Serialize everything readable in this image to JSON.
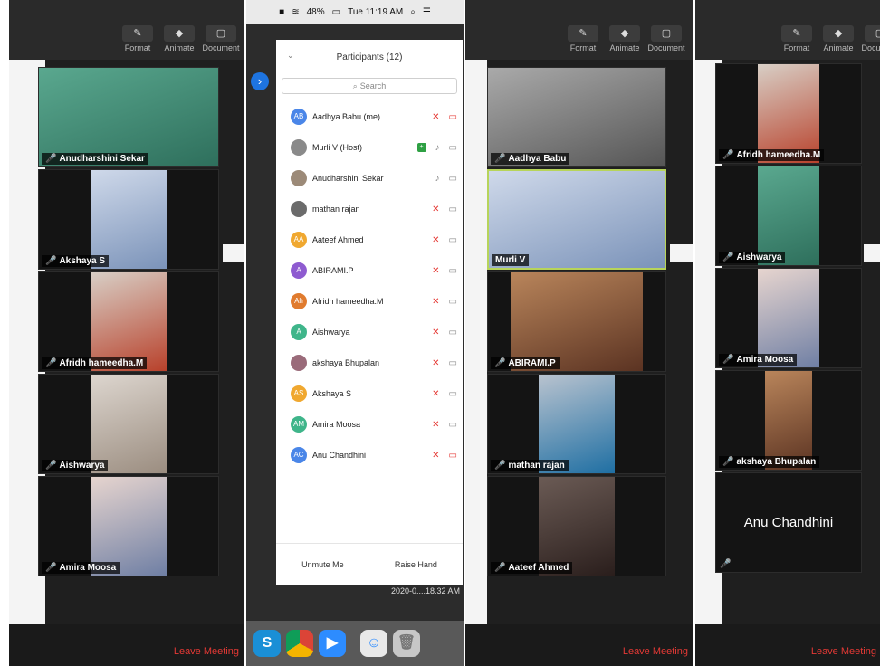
{
  "toolbar": {
    "format": "Format",
    "animate": "Animate",
    "document": "Document"
  },
  "leave_meeting": "Leave Meeting",
  "panel1": {
    "tiles": [
      {
        "name": "Anudharshini Sekar"
      },
      {
        "name": "Akshaya S"
      },
      {
        "name": "Afridh hameedha.M"
      },
      {
        "name": "Aishwarya"
      },
      {
        "name": "Amira Moosa"
      }
    ]
  },
  "mobile": {
    "status": {
      "battery": "48%",
      "time": "Tue 11:19 AM"
    },
    "participants_title": "Participants (12)",
    "search_placeholder": "Search",
    "participants": [
      {
        "initials": "AB",
        "name": "Aadhya Babu (me)",
        "color": "#4a86e8"
      },
      {
        "initials": "",
        "name": "Murli V (Host)",
        "color": "#8a8a8a"
      },
      {
        "initials": "",
        "name": "Anudharshini Sekar",
        "color": "#9c8a78"
      },
      {
        "initials": "",
        "name": "mathan rajan",
        "color": "#6b6b6b"
      },
      {
        "initials": "AA",
        "name": "Aateef Ahmed",
        "color": "#f0a830"
      },
      {
        "initials": "A",
        "name": "ABIRAMI.P",
        "color": "#8e5bd0"
      },
      {
        "initials": "Ah",
        "name": "Afridh hameedha.M",
        "color": "#e07b2e"
      },
      {
        "initials": "A",
        "name": "Aishwarya",
        "color": "#3fb58a"
      },
      {
        "initials": "",
        "name": "akshaya Bhupalan",
        "color": "#9a6b7a"
      },
      {
        "initials": "AS",
        "name": "Akshaya S",
        "color": "#f0a830"
      },
      {
        "initials": "AM",
        "name": "Amira Moosa",
        "color": "#3fb58a"
      },
      {
        "initials": "AC",
        "name": "Anu Chandhini",
        "color": "#4a86e8"
      }
    ],
    "unmute_label": "Unmute Me",
    "raise_hand_label": "Raise Hand",
    "timestamp": "2020-0....18.32 AM"
  },
  "panel3": {
    "tiles": [
      {
        "name": "Aadhya Babu"
      },
      {
        "name": "Murli V"
      },
      {
        "name": "ABIRAMI.P"
      },
      {
        "name": "mathan rajan"
      },
      {
        "name": "Aateef Ahmed"
      }
    ]
  },
  "panel4": {
    "tiles": [
      {
        "name": "Afridh hameedha.M"
      },
      {
        "name": "Aishwarya"
      },
      {
        "name": "Amira Moosa"
      },
      {
        "name": "akshaya Bhupalan"
      },
      {
        "name": "Anu Chandhini"
      }
    ]
  }
}
